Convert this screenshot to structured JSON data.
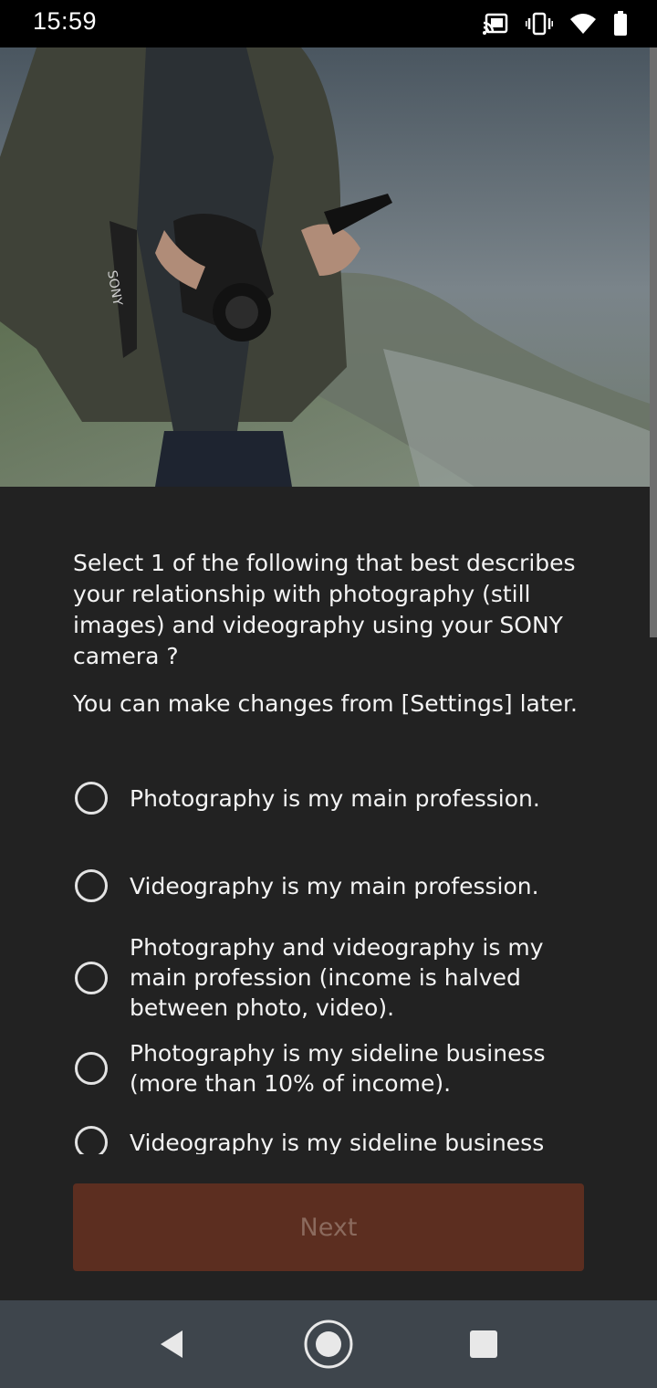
{
  "status_bar": {
    "time": "15:59",
    "icons": [
      "cast-icon",
      "vibrate-icon",
      "wifi-icon",
      "battery-icon"
    ]
  },
  "hero": {
    "icon": "photographer-holding-camera-image"
  },
  "main": {
    "question": "Select 1 of the following that best describes your relationship with photography (still images) and videography using your SONY camera ?",
    "hint": "You can make changes from [Settings] later.",
    "options": [
      {
        "label": "Photography is my main profession.",
        "selected": false
      },
      {
        "label": "Videography is my main profession.",
        "selected": false
      },
      {
        "label": "Photography and videography is my main profession (income is halved between photo, video).",
        "selected": false
      },
      {
        "label": "Photography is my sideline business (more than 10% of income).",
        "selected": false
      },
      {
        "label": "Videography is my sideline business",
        "selected": false
      }
    ],
    "next_label": "Next"
  },
  "nav_bar": {
    "icons": [
      "back-icon",
      "home-icon",
      "recents-icon"
    ]
  },
  "colors": {
    "background": "#222222",
    "button": "#5c2e20",
    "button_text": "#8b6a5d"
  }
}
